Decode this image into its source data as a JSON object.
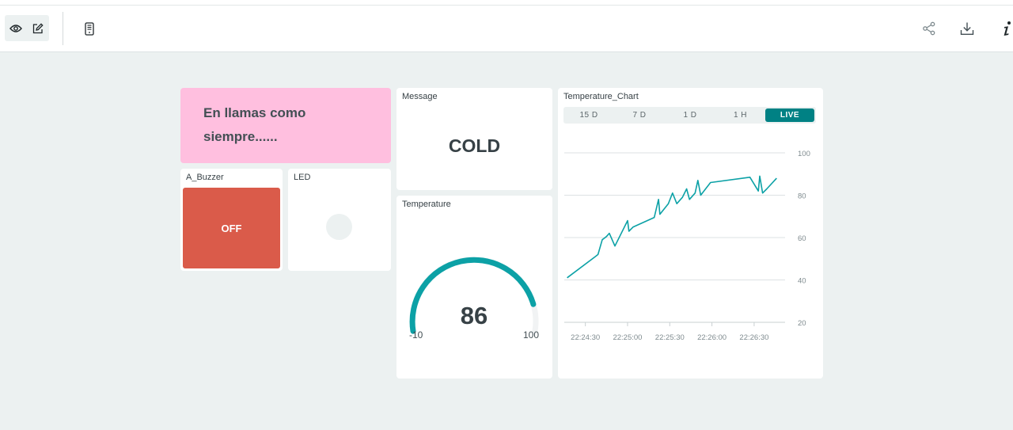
{
  "toolbar": {
    "view_icon": "eye-icon",
    "edit_icon": "pencil-icon",
    "mobile_icon": "mobile-phone-icon",
    "share_icon": "share-icon",
    "download_icon": "download-icon",
    "info_icon": "info-icon"
  },
  "widgets": {
    "message_text": {
      "line1": "En llamas como",
      "line2": "siempre......",
      "background": "#ffbfdf"
    },
    "buzzer": {
      "title": "A_Buzzer",
      "state": "OFF",
      "color": "#da5b4a"
    },
    "led": {
      "title": "LED",
      "state_color": "#ecf1f1"
    },
    "message": {
      "title": "Message",
      "value": "COLD"
    },
    "temperature": {
      "title": "Temperature",
      "value": "86",
      "min": "-10",
      "max": "100",
      "gauge_value": 86,
      "gauge_min": -10,
      "gauge_max": 100,
      "color": "#0ca1a6"
    },
    "chart": {
      "title": "Temperature_Chart",
      "ranges": [
        "15 D",
        "7 D",
        "1 D",
        "1 H",
        "LIVE"
      ],
      "active_range": "LIVE"
    }
  },
  "chart_data": {
    "type": "line",
    "title": "Temperature_Chart",
    "xlabel": "",
    "ylabel": "",
    "x_ticks": [
      "22:24:30",
      "22:25:00",
      "22:25:30",
      "22:26:00",
      "22:26:30"
    ],
    "y_ticks": [
      20,
      40,
      60,
      80,
      100
    ],
    "ylim": [
      20,
      100
    ],
    "xlim_seconds": [
      -15,
      142
    ],
    "grid": true,
    "color": "#0ca1a6",
    "series": [
      {
        "x": [
          -13,
          7,
          9,
          12,
          15,
          17,
          21,
          30,
          31,
          34,
          49,
          52,
          53,
          59,
          62,
          65,
          69,
          72,
          74,
          78,
          80,
          82,
          89,
          117,
          123,
          124,
          126,
          129,
          136
        ],
        "y": [
          41,
          51,
          52,
          59,
          60.5,
          62,
          56,
          68,
          63,
          65,
          69.5,
          78,
          71,
          76,
          81,
          76,
          79,
          83,
          78,
          81,
          87,
          80,
          86,
          88.5,
          82,
          89,
          81,
          83,
          88
        ]
      }
    ]
  }
}
